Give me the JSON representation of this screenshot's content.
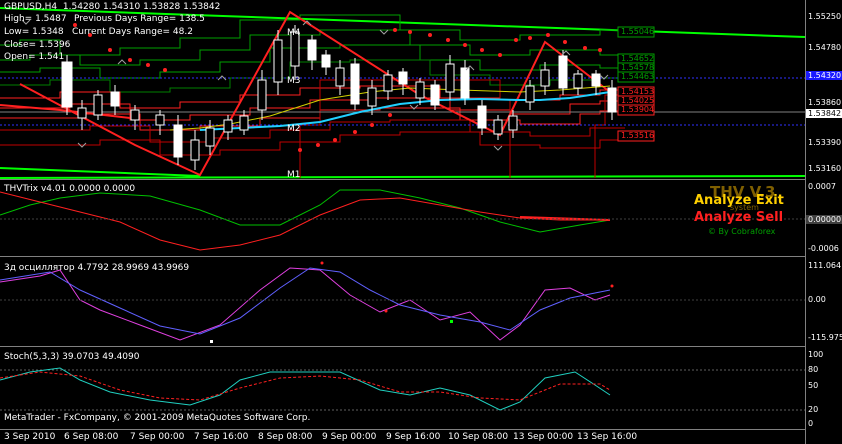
{
  "window": {
    "symbol_tf": "GBPUSD,H4",
    "ohlc": "1.54280 1.54310 1.53828 1.53842"
  },
  "info_lines": {
    "high": "High= 1.5487",
    "prev_range": "Previous Days Range= 138.5",
    "low": "Low= 1.5348",
    "curr_range": "Current Days Range= 48.2",
    "close": "Close= 1.5396",
    "open": "Open= 1.541"
  },
  "pivots": {
    "m4": "M4",
    "m3": "M3",
    "m2": "M2",
    "m1": "M1"
  },
  "price_axis": [
    {
      "label": "1.55250"
    },
    {
      "label": "1.54780"
    },
    {
      "label": "1.54320"
    },
    {
      "label": "1.53860"
    },
    {
      "label": "1.53390"
    },
    {
      "label": "1.53160"
    }
  ],
  "current_price": "1.53842",
  "highlighted_price": "1.54320",
  "level_labels": [
    {
      "text": "1.55046",
      "color": "#00a000"
    },
    {
      "text": "1.54652",
      "color": "#00a000"
    },
    {
      "text": "1.54578",
      "color": "#00a000"
    },
    {
      "text": "1.54463",
      "color": "#00a000"
    },
    {
      "text": "1.54153",
      "color": "#ff2020"
    },
    {
      "text": "1.54025",
      "color": "#ff2020"
    },
    {
      "text": "1.53904",
      "color": "#ff2020"
    },
    {
      "text": "1.53516",
      "color": "#ff2020"
    }
  ],
  "thv": {
    "title": "THVTrix v4.01 0.0000 0.0000",
    "axis": [
      "0.0007",
      "0.00000",
      "-0.0006"
    ],
    "logo": "THV V.3",
    "logo_sub": "system",
    "analyze_exit": "Analyze Exit",
    "analyze_sell": "Analyze Sell",
    "by": "© By Cobraforex"
  },
  "osc": {
    "title": "3д осциллятор 4.7792 28.9969 43.9969",
    "axis": [
      "111.064",
      "0.00",
      "-115.975"
    ]
  },
  "stoch": {
    "title": "Stoch(5,3,3) 39.0703 49.4090",
    "axis": [
      "100",
      "80",
      "50",
      "20",
      "0"
    ],
    "copyright": "MetaTrader - FxCompany, © 2001-2009 MetaQuotes Software Corp."
  },
  "time_axis": [
    "3 Sep 2010",
    "6 Sep 08:00",
    "7 Sep 00:00",
    "7 Sep 16:00",
    "8 Sep 08:00",
    "9 Sep 00:00",
    "9 Sep 16:00",
    "10 Sep 08:00",
    "13 Sep 00:00",
    "13 Sep 16:00"
  ]
}
